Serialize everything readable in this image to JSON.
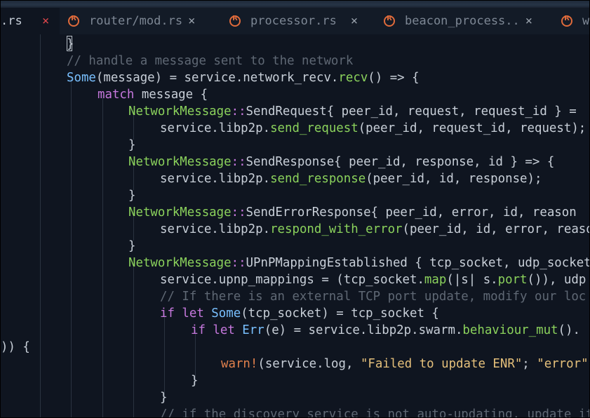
{
  "tabs": [
    {
      "label": ".rs",
      "close": "×",
      "active": true
    },
    {
      "label": "router/mod.rs",
      "close": "×"
    },
    {
      "label": "processor.rs",
      "close": "×"
    },
    {
      "label": "beacon_process..",
      "close": "×"
    },
    {
      "label": "w",
      "close": ""
    }
  ],
  "code": {
    "l0": "}",
    "l1": "// handle a message sent to the network",
    "l2_a": "Some",
    "l2_b": "(message) = service.network_recv.",
    "l2_c": "recv",
    "l2_d": "() => {",
    "l3_a": "match",
    "l3_b": " message {",
    "l4_a": "NetworkMessage",
    "l4_b": "::",
    "l4_c": "SendRequest{ peer_id, request, request_id } =",
    "l5_a": "service.libp2p.",
    "l5_b": "send_request",
    "l5_c": "(peer_id, request_id, request);",
    "l6": "}",
    "l7_a": "NetworkMessage",
    "l7_b": "::",
    "l7_c": "SendResponse{ peer_id, response, id } => {",
    "l8_a": "service.libp2p.",
    "l8_b": "send_response",
    "l8_c": "(peer_id, id, response);",
    "l9": "}",
    "l10_a": "NetworkMessage",
    "l10_b": "::",
    "l10_c": "SendErrorResponse{ peer_id, error, id, reason",
    "l11_a": "service.libp2p.",
    "l11_b": "respond_with_error",
    "l11_c": "(peer_id, id, error, reason",
    "l12": "}",
    "l13_a": "NetworkMessage",
    "l13_b": "::",
    "l13_c": "UPnPMappingEstablished { tcp_socket, udp_socket",
    "l14_a": "service.upnp_mappings = (tcp_socket.",
    "l14_b": "map",
    "l14_c": "(|s| s.",
    "l14_d": "port",
    "l14_e": "()), udp",
    "l15": "// If there is an external TCP port update, modify our loc",
    "l16_a": "if let ",
    "l16_b": "Some",
    "l16_c": "(tcp_socket) = tcp_socket {",
    "l17_a": "if let ",
    "l17_b": "Err",
    "l17_c": "(e) = service.libp2p.swarm.",
    "l17_d": "behaviour_mut",
    "l17_e": "().",
    "l18": ")) {",
    "l19_a": "warn!",
    "l19_b": "(service.log, ",
    "l19_c": "\"Failed to update ENR\"",
    "l19_d": "; ",
    "l19_e": "\"error\"",
    "l20": "}",
    "l21": "}",
    "l22": "// if the discovery service is not auto-updating, update it"
  }
}
